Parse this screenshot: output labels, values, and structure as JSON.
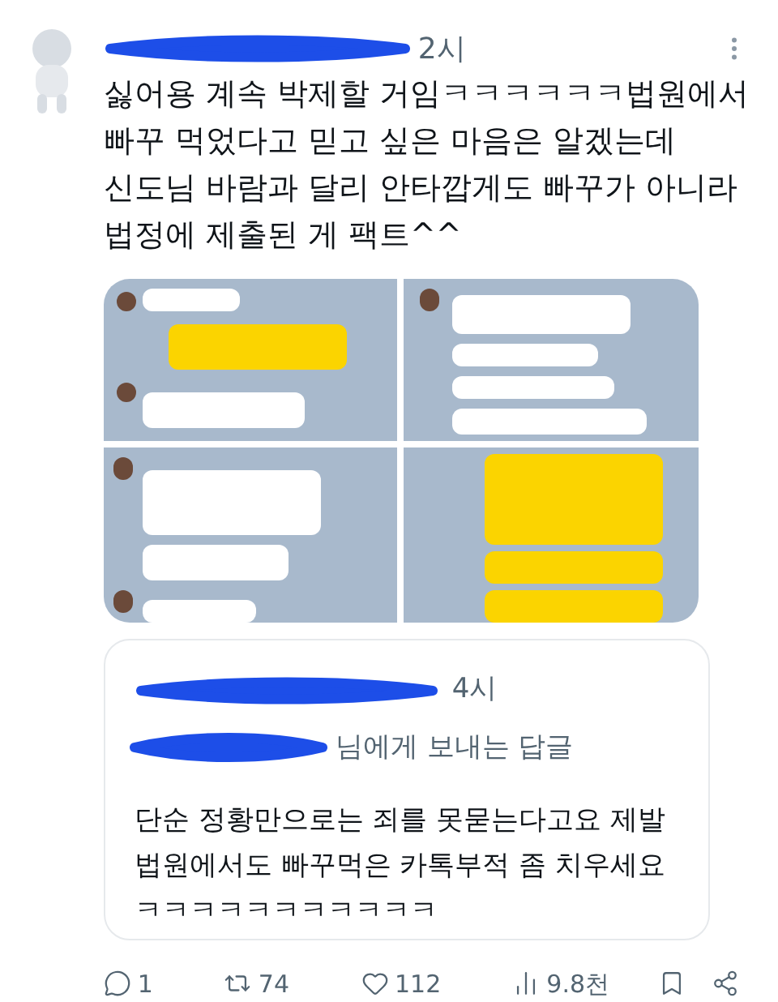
{
  "post": {
    "time": "2시",
    "text_lines": [
      "싫어용 계속 박제할 거임ㅋㅋㅋㅋㅋㅋ법원에서",
      "빠꾸 먹었다고 믿고 싶은 마음은 알겠는데",
      "신도님 바람과 달리 안타깝게도 빠꾸가 아니라",
      "법정에 제출된 게 팩트^^"
    ]
  },
  "quoted": {
    "time": "4시",
    "reply_to": "님에게 보내는 답글",
    "text_lines": [
      "단순 정황만으로는 죄를 못묻는다고요 제발",
      "법원에서도 빠꾸먹은 카톡부적 좀 치우세요",
      "ㅋㅋㅋㅋㅋㅋㅋㅋㅋㅋㅋ"
    ]
  },
  "actions": [
    {
      "kind": "reply",
      "count": "1"
    },
    {
      "kind": "repost",
      "count": "74"
    },
    {
      "kind": "like",
      "count": "112"
    },
    {
      "kind": "views",
      "count": "9.8천"
    },
    {
      "kind": "bookmark"
    },
    {
      "kind": "share"
    }
  ]
}
